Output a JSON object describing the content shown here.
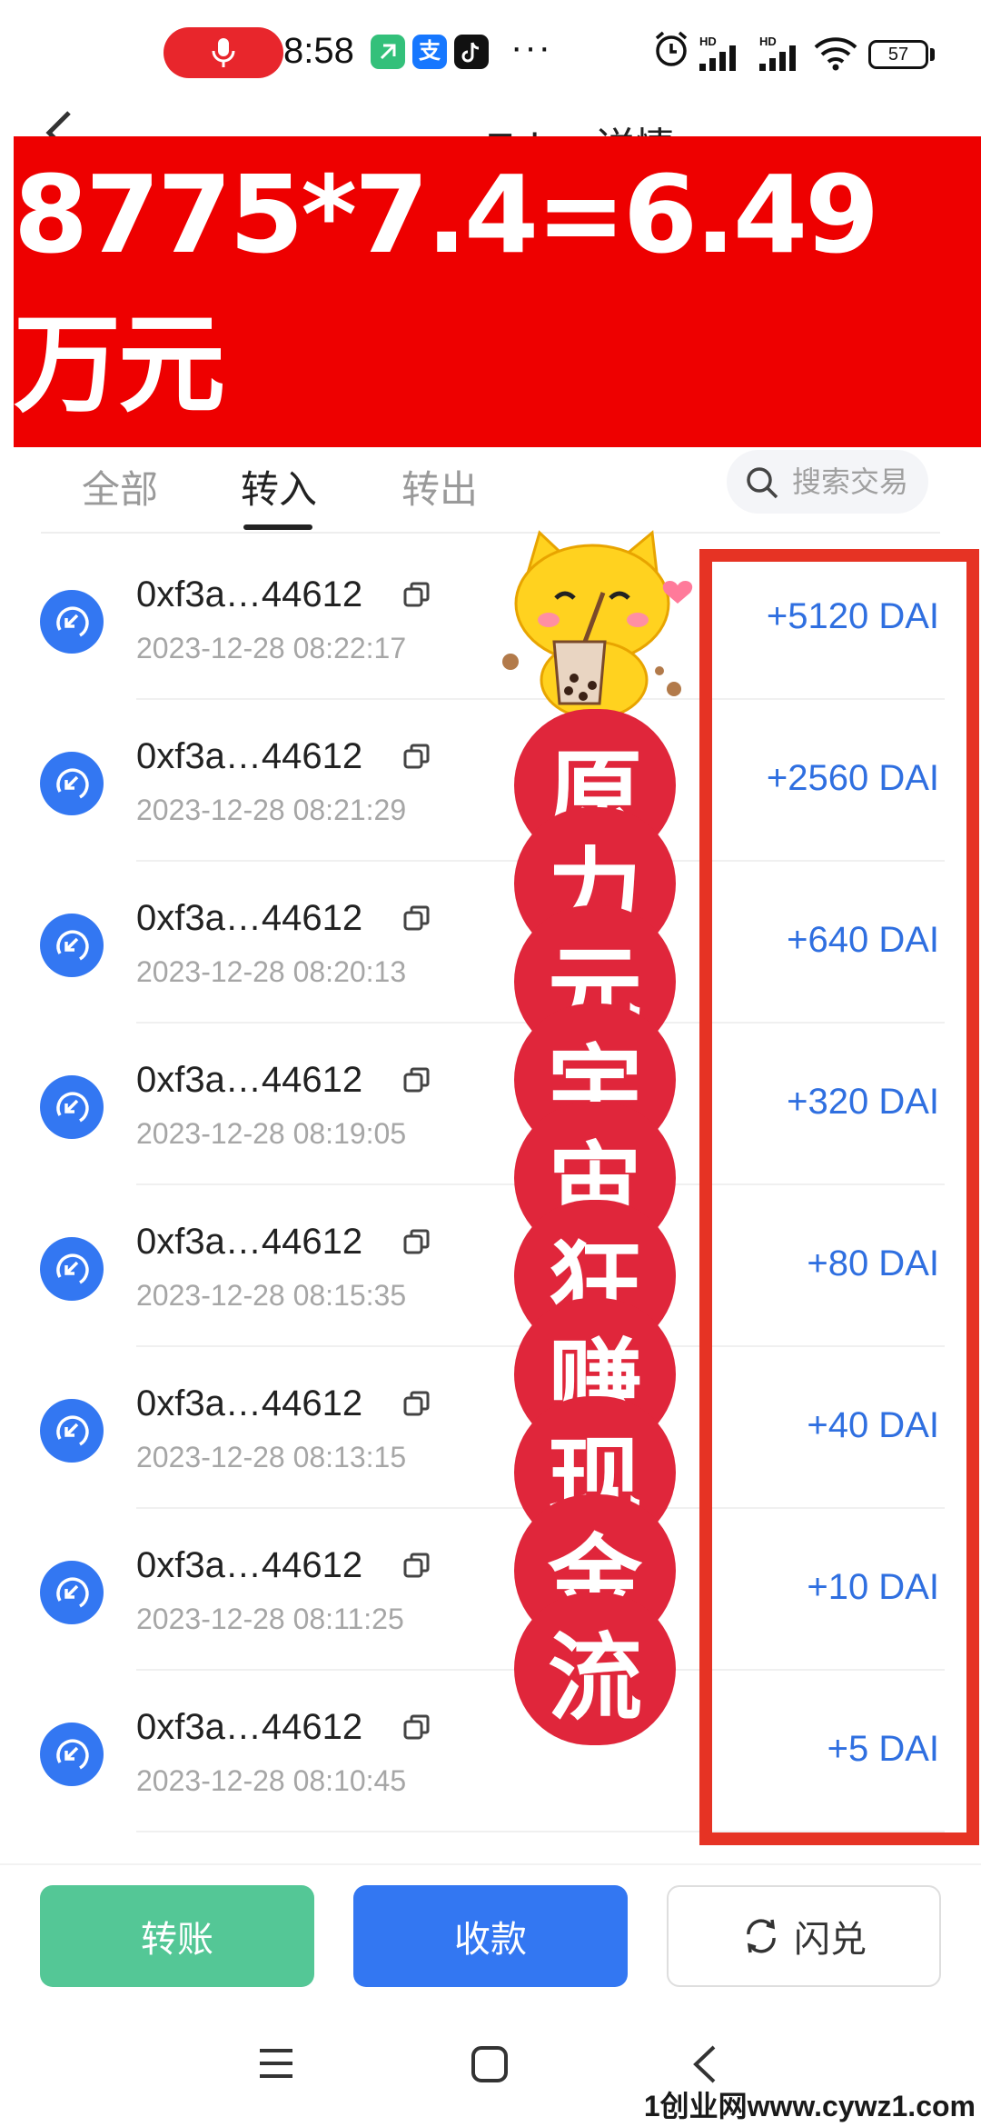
{
  "status_bar": {
    "time": "8:58",
    "more": "···",
    "battery": "57",
    "hd1": "HD",
    "hd2": "HD",
    "app_icons": [
      "app-green-icon",
      "alipay-icon",
      "tiktok-icon"
    ]
  },
  "header": {
    "title": "Token详情"
  },
  "banner": {
    "text": "8775*7.4=6.49万元",
    "color": "#ee0000"
  },
  "tabs": [
    {
      "label": "全部"
    },
    {
      "label": "转入"
    },
    {
      "label": "转出"
    }
  ],
  "search": {
    "placeholder": "搜索交易"
  },
  "transactions": [
    {
      "address": "0xf3a…44612",
      "time": "2023-12-28 08:22:17",
      "amount": "+5120 DAI"
    },
    {
      "address": "0xf3a…44612",
      "time": "2023-12-28 08:21:29",
      "amount": "+2560 DAI"
    },
    {
      "address": "0xf3a…44612",
      "time": "2023-12-28 08:20:13",
      "amount": "+640 DAI"
    },
    {
      "address": "0xf3a…44612",
      "time": "2023-12-28 08:19:05",
      "amount": "+320 DAI"
    },
    {
      "address": "0xf3a…44612",
      "time": "2023-12-28 08:15:35",
      "amount": "+80 DAI"
    },
    {
      "address": "0xf3a…44612",
      "time": "2023-12-28 08:13:15",
      "amount": "+40 DAI"
    },
    {
      "address": "0xf3a…44612",
      "time": "2023-12-28 08:11:25",
      "amount": "+10 DAI"
    },
    {
      "address": "0xf3a…44612",
      "time": "2023-12-28 08:10:45",
      "amount": "+5 DAI"
    }
  ],
  "overlay_vertical_text": [
    "原",
    "力",
    "元",
    "宇",
    "宙",
    "狂",
    "赚",
    "现",
    "金",
    "流"
  ],
  "actions": {
    "transfer": "转账",
    "receive": "收款",
    "exchange": "闪兑"
  },
  "watermark": "1创业网www.cywz1.com",
  "colors": {
    "accent_blue": "#3377f2",
    "transfer_green": "#54c796",
    "amount_blue": "#2f6fe0",
    "overlay_red": "#e63324"
  }
}
